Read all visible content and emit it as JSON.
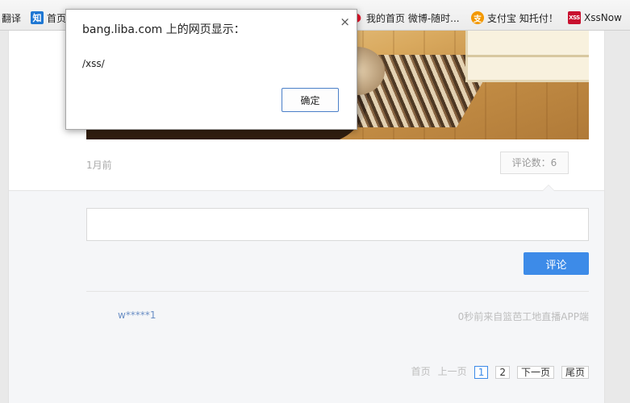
{
  "bookmarks": [
    {
      "label": "翻译",
      "icon": "translate-icon"
    },
    {
      "label": "首页",
      "icon": "zhihu-icon",
      "icon_text": "知"
    },
    {
      "label": "我的首页 微博-随时...",
      "icon": "weibo-icon",
      "icon_text": "●"
    },
    {
      "label": "支付宝 知托付！",
      "icon": "alipay-icon",
      "icon_text": "支"
    },
    {
      "label": "XssNow",
      "icon": "xssnow-icon",
      "icon_text": "XSS"
    }
  ],
  "post": {
    "time_ago": "1月前",
    "comment_count_label": "评论数：6"
  },
  "comment_form": {
    "input_value": "",
    "input_placeholder": "",
    "submit_label": "评论"
  },
  "comments": [
    {
      "user": "w*****1",
      "meta": "0秒前来自篮芭工地直播APP端"
    }
  ],
  "pagination": {
    "first": "首页",
    "prev": "上一页",
    "pages": [
      "1",
      "2"
    ],
    "current_page": "1",
    "next": "下一页",
    "last": "尾页"
  },
  "alert": {
    "title": "bang.liba.com 上的网页显示：",
    "message": "/xss/",
    "ok_label": "确定",
    "close_glyph": "×"
  },
  "colors": {
    "accent": "#3d8be8",
    "username": "#6b8fc5",
    "muted": "#bdbdbd"
  }
}
